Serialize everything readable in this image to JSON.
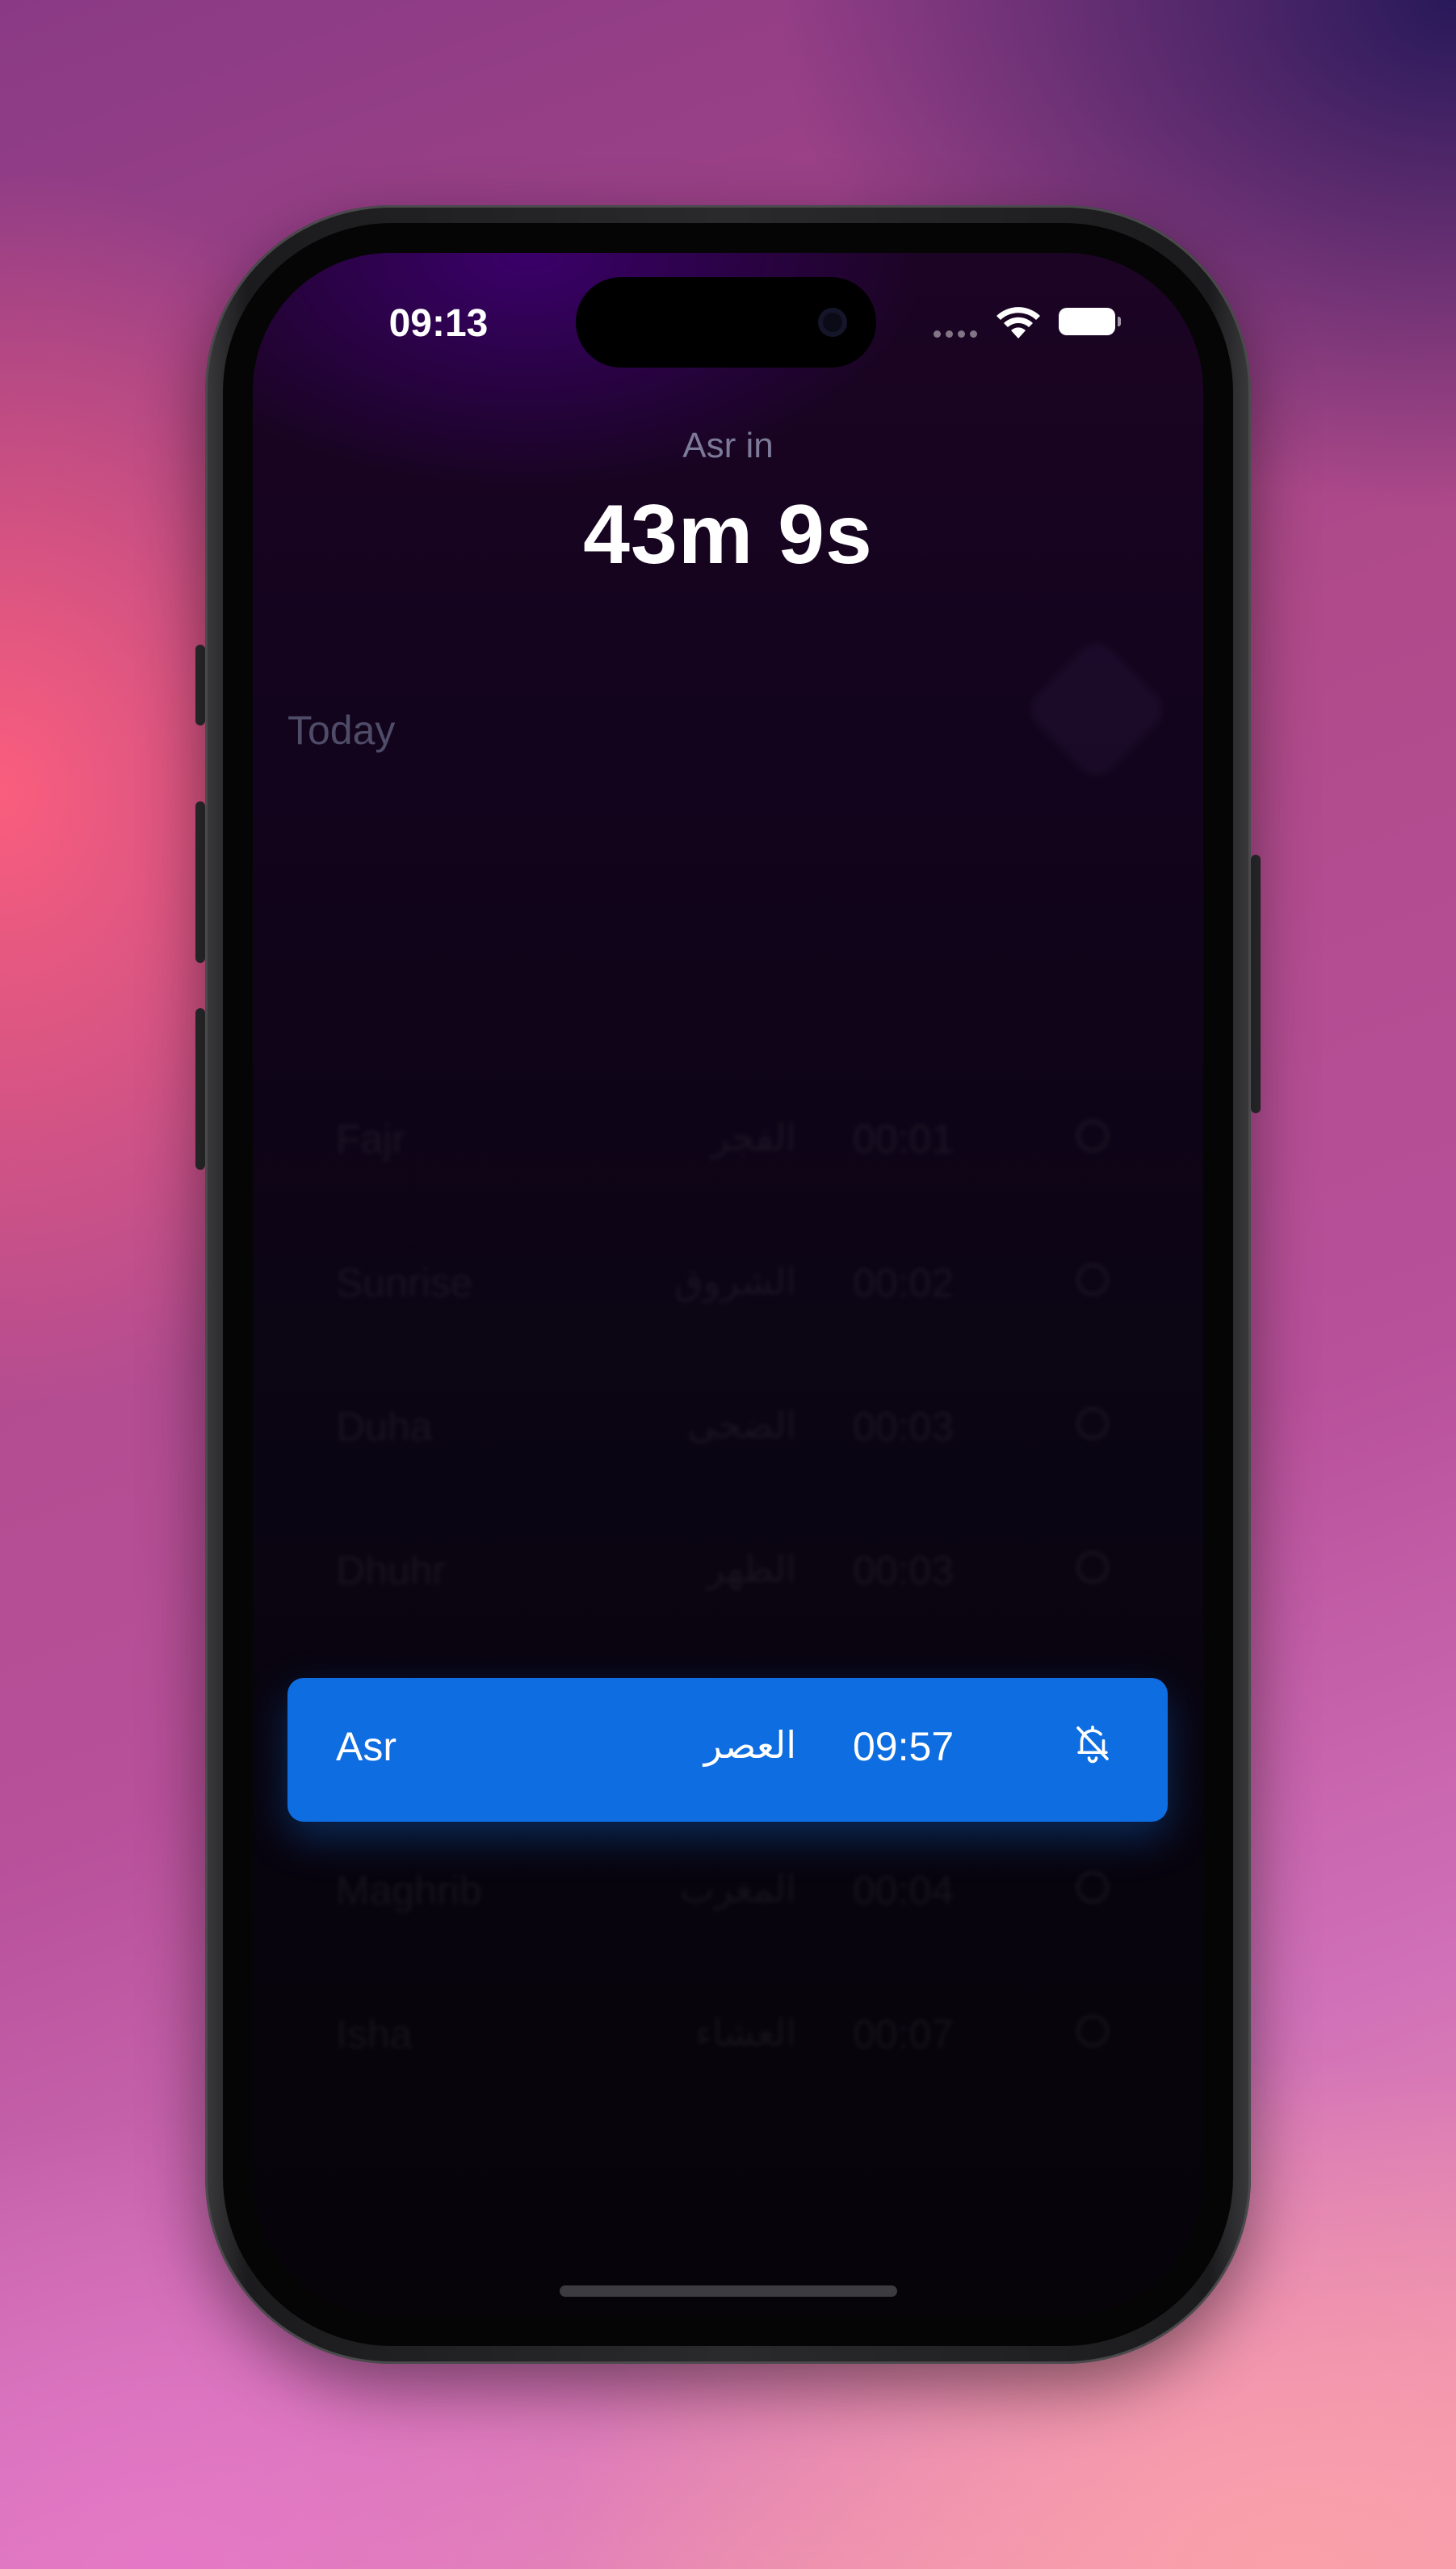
{
  "status_bar": {
    "time": "09:13"
  },
  "next_prayer": {
    "label": "Asr in",
    "countdown": "43m 9s"
  },
  "day": {
    "title": "Today"
  },
  "prayers": [
    {
      "name": "Fajr",
      "arabic": "الفجر",
      "time": "00:01",
      "active": false
    },
    {
      "name": "Sunrise",
      "arabic": "الشروق",
      "time": "00:02",
      "active": false
    },
    {
      "name": "Duha",
      "arabic": "الضحى",
      "time": "00:03",
      "active": false
    },
    {
      "name": "Dhuhr",
      "arabic": "الظهر",
      "time": "00:03",
      "active": false
    },
    {
      "name": "Asr",
      "arabic": "العصر",
      "time": "09:57",
      "active": true
    },
    {
      "name": "Maghrib",
      "arabic": "المغرب",
      "time": "00:04",
      "active": false
    },
    {
      "name": "Isha",
      "arabic": "العشاء",
      "time": "00:07",
      "active": false
    }
  ],
  "colors": {
    "accent": "#0e6de0",
    "background_top": "#1c0424",
    "background_bottom": "#060309",
    "muted_text": "#7c7a98"
  },
  "icons": {
    "bell": "bell-slash-icon",
    "compass": "qibla-compass-icon"
  }
}
